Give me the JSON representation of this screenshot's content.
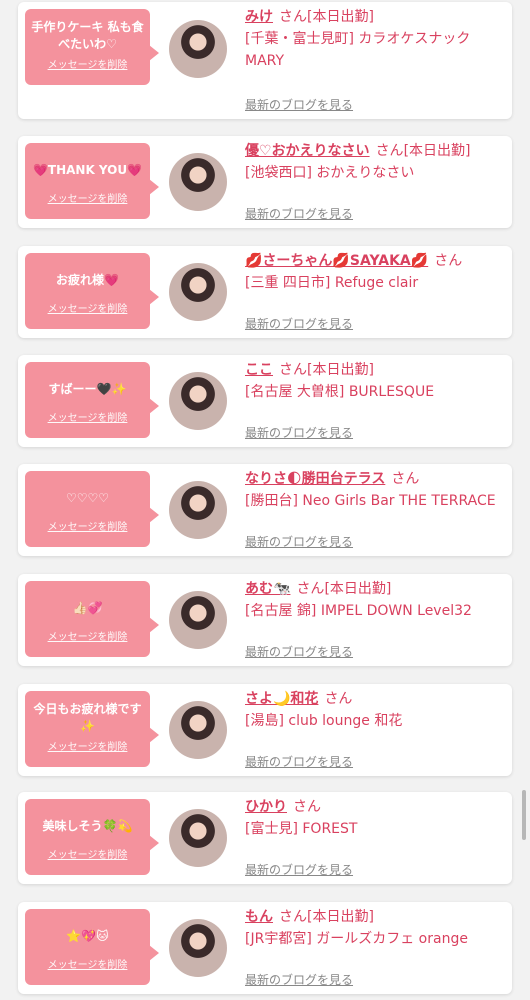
{
  "delete_label": "メッセージを削除",
  "blog_label": "最新のブログを見る",
  "san": "さん",
  "cards": [
    {
      "message": "手作りケーキ 私も食べたいわ♡",
      "name": "みけ",
      "status": "[本日出勤]",
      "shop": "[千葉・富士見町] カラオケスナック MARY"
    },
    {
      "message": "💗THANK YOU💗",
      "name": "優♡おかえりなさい",
      "status": "[本日出勤]",
      "shop": "[池袋西口] おかえりなさい"
    },
    {
      "message": "お疲れ様💗",
      "name": "💋さーちゃん💋SAYAKA💋",
      "status": "",
      "shop": "[三重 四日市] Refuge clair"
    },
    {
      "message": "すばーー🖤✨",
      "name": "ここ",
      "status": "[本日出勤]",
      "shop": "[名古屋 大曽根] BURLESQUE"
    },
    {
      "message": "♡♡♡♡",
      "name": "なりさ🌓勝田台テラス",
      "status": "",
      "shop": "[勝田台] Neo Girls Bar THE TERRACE"
    },
    {
      "message": "👍🏻💞",
      "name": "あむ🐄",
      "status": "[本日出勤]",
      "shop": "[名古屋 錦] IMPEL DOWN Level32"
    },
    {
      "message": "今日もお疲れ様です✨",
      "name": "さよ🌙和花",
      "status": "",
      "shop": "[湯島] club lounge 和花"
    },
    {
      "message": "美味しそう🍀💫",
      "name": "ひかり",
      "status": "",
      "shop": "[富士見] FOREST"
    },
    {
      "message": "⭐💖🐱",
      "name": "もん",
      "status": "[本日出勤]",
      "shop": "[JR宇都宮] ガールズカフェ orange"
    }
  ]
}
